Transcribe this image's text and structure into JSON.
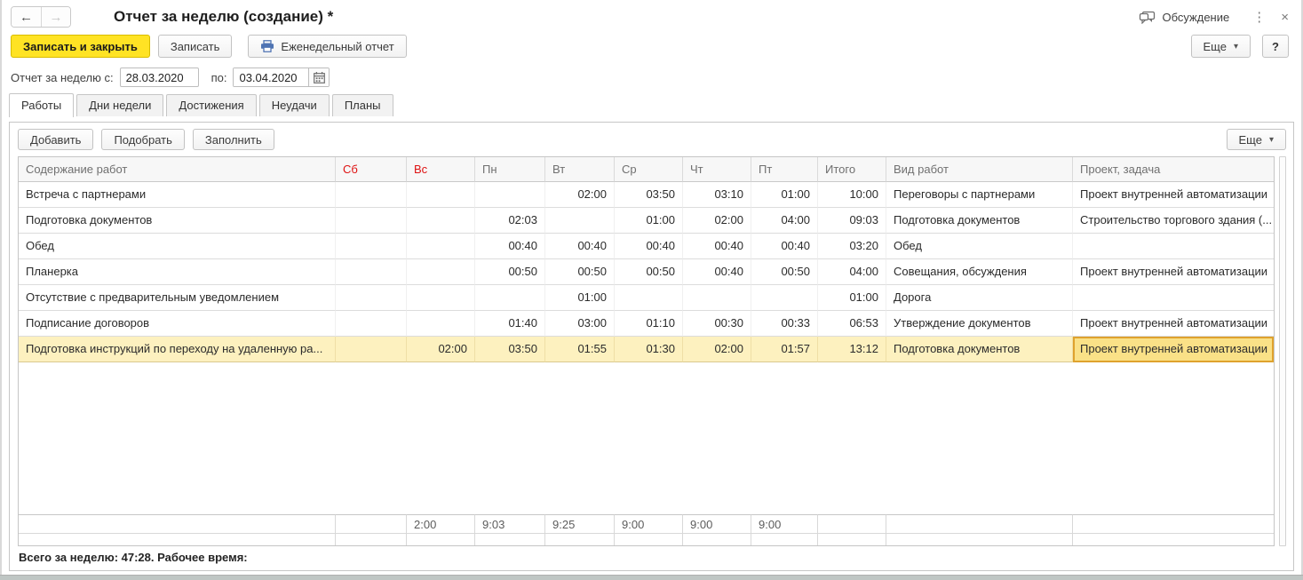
{
  "colors": {
    "accent_yellow": "#FFE324",
    "weekend_red": "#DE1212",
    "selection_border": "#DFA22E",
    "selection_fill": "#FAE187",
    "row_highlight": "#FDF1BF",
    "print_icon_blue": "#4F74B3"
  },
  "icons": {
    "back": "←",
    "forward": "→",
    "menu": "⋮",
    "close": "×",
    "dropdown": "▾"
  },
  "window": {
    "title": "Отчет за неделю (создание) *",
    "discussion": "Обсуждение"
  },
  "toolbar": {
    "save_close": "Записать и закрыть",
    "save": "Записать",
    "weekly_report": "Еженедельный отчет",
    "more": "Еще",
    "help": "?"
  },
  "period": {
    "from_label": "Отчет за неделю с:",
    "from_value": "28.03.2020",
    "to_label": "по:",
    "to_value": "03.04.2020"
  },
  "tabs": [
    {
      "label": "Работы",
      "active": true
    },
    {
      "label": "Дни недели",
      "active": false
    },
    {
      "label": "Достижения",
      "active": false
    },
    {
      "label": "Неудачи",
      "active": false
    },
    {
      "label": "Планы",
      "active": false
    }
  ],
  "grid_toolbar": {
    "add": "Добавить",
    "pick": "Подобрать",
    "fill": "Заполнить",
    "more": "Еще"
  },
  "table": {
    "columns": [
      {
        "label": "Содержание работ",
        "weekend": false
      },
      {
        "label": "Сб",
        "weekend": true
      },
      {
        "label": "Вс",
        "weekend": true
      },
      {
        "label": "Пн",
        "weekend": false
      },
      {
        "label": "Вт",
        "weekend": false
      },
      {
        "label": "Ср",
        "weekend": false
      },
      {
        "label": "Чт",
        "weekend": false
      },
      {
        "label": "Пт",
        "weekend": false
      },
      {
        "label": "Итого",
        "weekend": false
      },
      {
        "label": "Вид работ",
        "weekend": false
      },
      {
        "label": "Проект, задача",
        "weekend": false
      }
    ],
    "rows": [
      {
        "cells": [
          "Встреча с партнерами",
          "",
          "",
          "",
          "02:00",
          "03:50",
          "03:10",
          "01:00",
          "10:00",
          "Переговоры с партнерами",
          "Проект внутренней автоматизации"
        ]
      },
      {
        "cells": [
          "Подготовка документов",
          "",
          "",
          "02:03",
          "",
          "01:00",
          "02:00",
          "04:00",
          "09:03",
          "Подготовка документов",
          "Строительство торгового здания (..."
        ]
      },
      {
        "cells": [
          "Обед",
          "",
          "",
          "00:40",
          "00:40",
          "00:40",
          "00:40",
          "00:40",
          "03:20",
          "Обед",
          ""
        ]
      },
      {
        "cells": [
          "Планерка",
          "",
          "",
          "00:50",
          "00:50",
          "00:50",
          "00:40",
          "00:50",
          "04:00",
          "Совещания, обсуждения",
          "Проект внутренней автоматизации"
        ]
      },
      {
        "cells": [
          "Отсутствие с предварительным уведомлением",
          "",
          "",
          "",
          "01:00",
          "",
          "",
          "",
          "01:00",
          "Дорога",
          ""
        ]
      },
      {
        "cells": [
          "Подписание договоров",
          "",
          "",
          "01:40",
          "03:00",
          "01:10",
          "00:30",
          "00:33",
          "06:53",
          "Утверждение документов",
          "Проект внутренней автоматизации"
        ]
      },
      {
        "cells": [
          "Подготовка инструкций по переходу на удаленную ра...",
          "",
          "02:00",
          "03:50",
          "01:55",
          "01:30",
          "02:00",
          "01:57",
          "13:12",
          "Подготовка документов",
          "Проект внутренней автоматизации"
        ]
      }
    ],
    "totals": {
      "cells": [
        "",
        "",
        "2:00",
        "9:03",
        "9:25",
        "9:00",
        "9:00",
        "9:00",
        "",
        "",
        ""
      ]
    }
  },
  "footer": {
    "summary": "Всего за неделю: 47:28. Рабочее время:"
  }
}
